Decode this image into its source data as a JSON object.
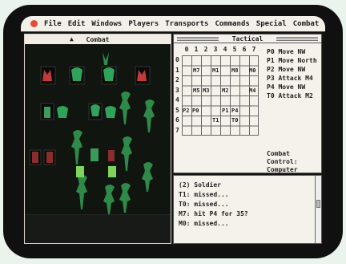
{
  "menubar": {
    "items": [
      "File",
      "Edit",
      "Windows",
      "Players",
      "Transports",
      "Commands",
      "Special",
      "Combat"
    ]
  },
  "combat_window": {
    "title": "Combat"
  },
  "tactical_window": {
    "title": "Tactical",
    "columns": [
      "0",
      "1",
      "2",
      "3",
      "4",
      "5",
      "6",
      "7",
      "8"
    ],
    "rows": [
      "0",
      "1",
      "2",
      "3",
      "4",
      "5",
      "6",
      "7"
    ],
    "tokens": [
      "M7",
      "M1",
      "M8",
      "M0",
      "M5",
      "M3",
      "M2",
      "M4",
      "P2",
      "P0",
      "P1",
      "P4",
      "T1",
      "T0"
    ],
    "orders": [
      {
        "unit": "P0",
        "text": "Move NW"
      },
      {
        "unit": "P1",
        "text": "Move North"
      },
      {
        "unit": "P2",
        "text": "Move NW"
      },
      {
        "unit": "P3",
        "text": "Attack M4"
      },
      {
        "unit": "P4",
        "text": "Move NW"
      },
      {
        "unit": "T0",
        "text": "Attack M2"
      }
    ],
    "control_label": "Combat Control:",
    "control_value": "Computer"
  },
  "message_window": {
    "lines": [
      "(2) Soldier",
      "T1: missed...",
      "T0: missed...",
      "M7: hit P4 for 35?",
      "M0: missed..."
    ]
  },
  "colors": {
    "menubar_bg": "#f3efe9",
    "apple_logo": "#e24c3c",
    "panel_bg": "#f5f2ec",
    "battlefield_bg": "#101510",
    "tree_green": "#2f8a4a",
    "unit_green": "#2fa35a"
  }
}
